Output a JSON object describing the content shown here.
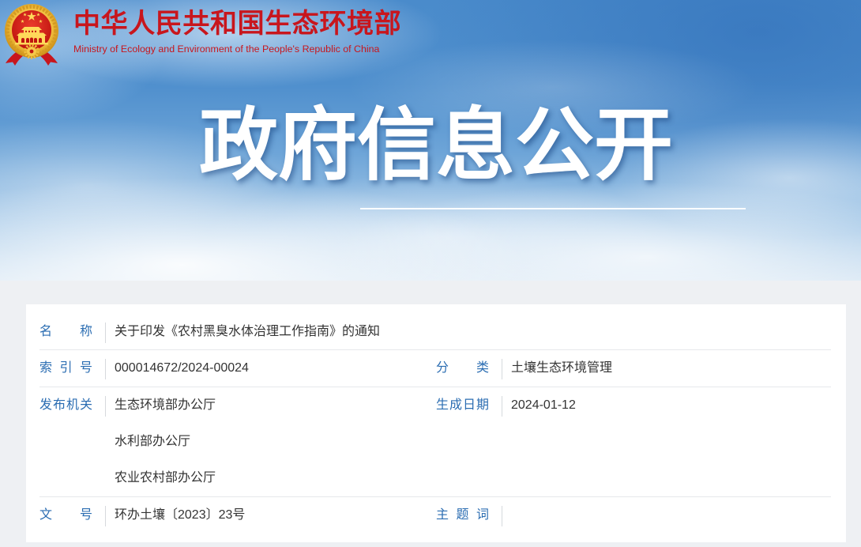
{
  "header": {
    "emblem_icon": "national-emblem-icon",
    "title_cn": "中华人民共和国生态环境部",
    "title_en": "Ministry of Ecology and Environment of the People's Republic of China",
    "brand_color": "#c8161d"
  },
  "banner": {
    "heading": "政府信息公开"
  },
  "info": {
    "label_color": "#2b6db2",
    "value_color": "#333333",
    "title": {
      "label": "名　　称",
      "value": "关于印发《农村黑臭水体治理工作指南》的通知"
    },
    "index_no": {
      "label": "索 引 号",
      "value": "000014672/2024-00024"
    },
    "category": {
      "label": "分　　类",
      "value": "土壤生态环境管理"
    },
    "issuer": {
      "label": "发布机关",
      "values": [
        "生态环境部办公厅",
        "水利部办公厅",
        "农业农村部办公厅"
      ]
    },
    "date": {
      "label": "生成日期",
      "value": "2024-01-12"
    },
    "doc_no": {
      "label": "文　　号",
      "value": "环办土壤〔2023〕23号"
    },
    "keywords": {
      "label": "主 题 词"
    }
  }
}
